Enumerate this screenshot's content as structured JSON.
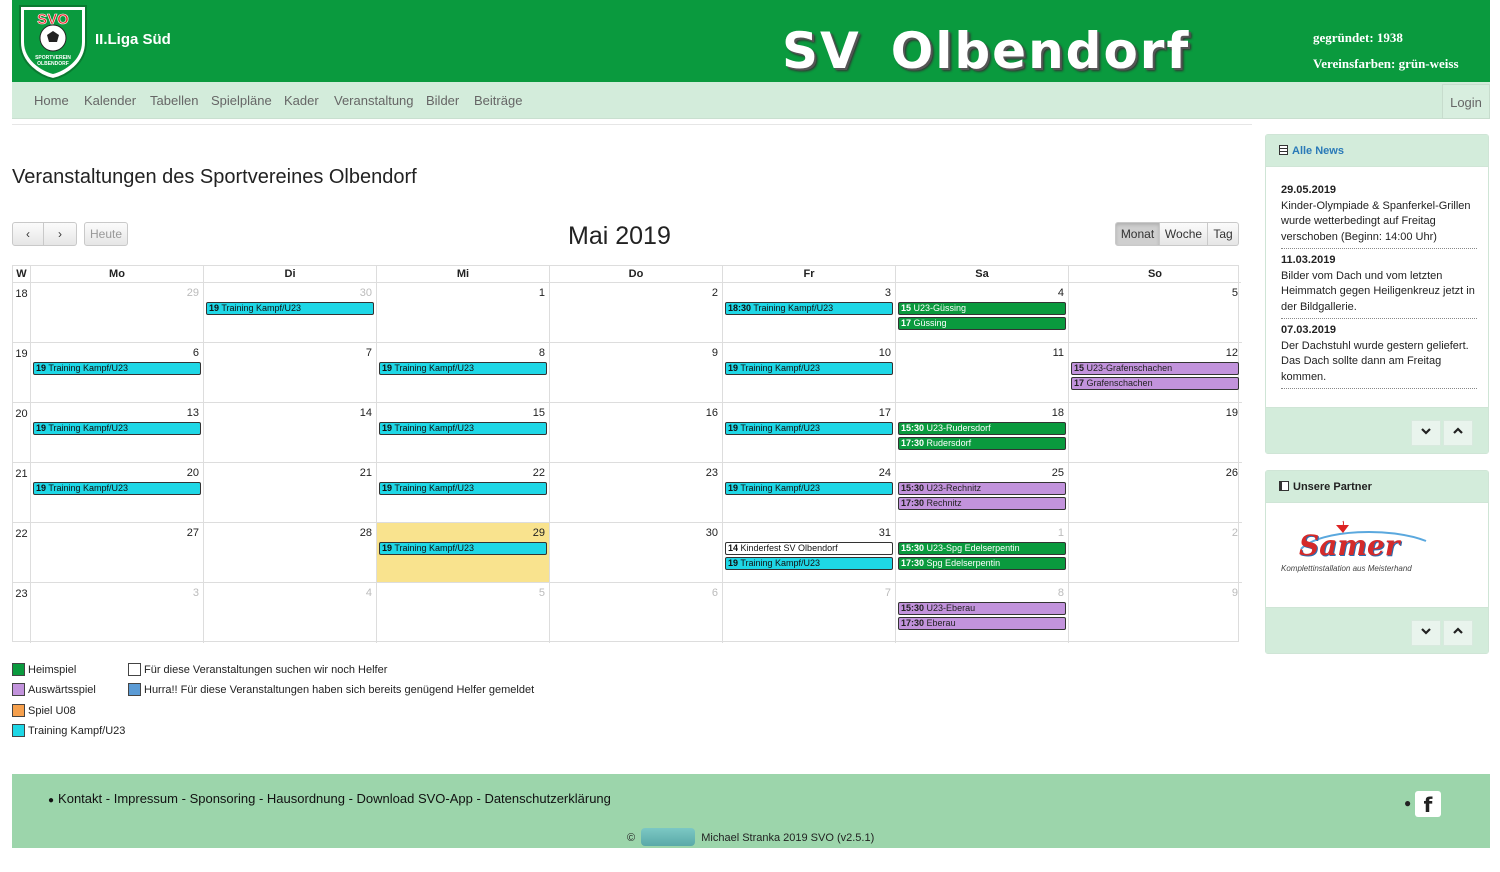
{
  "header": {
    "league": "II.Liga Süd",
    "club_title_part1": "SV",
    "club_title_part2": "Olbendorf",
    "founded": "gegründet: 1938",
    "club_colors": "Vereinsfarben: grün-weiss",
    "logo_text_top": "SVO",
    "logo_text_bottom": "SPORTVEREIN OLBENDORF"
  },
  "nav": {
    "items": [
      "Home",
      "Kalender",
      "Tabellen",
      "Spielpläne",
      "Kader",
      "Veranstaltung",
      "Bilder",
      "Beiträge"
    ],
    "login": "Login"
  },
  "page": {
    "title": "Veranstaltungen des Sportvereines Olbendorf"
  },
  "toolbar": {
    "prev": "‹",
    "next": "›",
    "today": "Heute",
    "title": "Mai 2019",
    "views": [
      "Monat",
      "Woche",
      "Tag"
    ],
    "active_view": "Monat"
  },
  "calendar": {
    "week_col_header": "W",
    "day_headers": [
      "Mo",
      "Di",
      "Mi",
      "Do",
      "Fr",
      "Sa",
      "So"
    ],
    "weeks": [
      {
        "week": "18",
        "days": [
          {
            "num": "29",
            "other": true,
            "events": []
          },
          {
            "num": "30",
            "other": true,
            "events": [
              {
                "time": "19",
                "text": "Training Kampf/U23",
                "type": "training"
              }
            ]
          },
          {
            "num": "1",
            "events": []
          },
          {
            "num": "2",
            "events": []
          },
          {
            "num": "3",
            "events": [
              {
                "time": "18:30",
                "text": "Training Kampf/U23",
                "type": "training"
              }
            ]
          },
          {
            "num": "4",
            "events": [
              {
                "time": "15",
                "text": "U23-Güssing",
                "type": "home"
              },
              {
                "time": "17",
                "text": "Güssing",
                "type": "home"
              }
            ]
          },
          {
            "num": "5",
            "events": []
          }
        ]
      },
      {
        "week": "19",
        "days": [
          {
            "num": "6",
            "events": [
              {
                "time": "19",
                "text": "Training Kampf/U23",
                "type": "training"
              }
            ]
          },
          {
            "num": "7",
            "events": []
          },
          {
            "num": "8",
            "events": [
              {
                "time": "19",
                "text": "Training Kampf/U23",
                "type": "training"
              }
            ]
          },
          {
            "num": "9",
            "events": []
          },
          {
            "num": "10",
            "events": [
              {
                "time": "19",
                "text": "Training Kampf/U23",
                "type": "training"
              }
            ]
          },
          {
            "num": "11",
            "events": []
          },
          {
            "num": "12",
            "events": [
              {
                "time": "15",
                "text": "U23-Grafenschachen",
                "type": "away"
              },
              {
                "time": "17",
                "text": "Grafenschachen",
                "type": "away"
              }
            ]
          }
        ]
      },
      {
        "week": "20",
        "days": [
          {
            "num": "13",
            "events": [
              {
                "time": "19",
                "text": "Training Kampf/U23",
                "type": "training"
              }
            ]
          },
          {
            "num": "14",
            "events": []
          },
          {
            "num": "15",
            "events": [
              {
                "time": "19",
                "text": "Training Kampf/U23",
                "type": "training"
              }
            ]
          },
          {
            "num": "16",
            "events": []
          },
          {
            "num": "17",
            "events": [
              {
                "time": "19",
                "text": "Training Kampf/U23",
                "type": "training"
              }
            ]
          },
          {
            "num": "18",
            "events": [
              {
                "time": "15:30",
                "text": "U23-Rudersdorf",
                "type": "home"
              },
              {
                "time": "17:30",
                "text": "Rudersdorf",
                "type": "home"
              }
            ]
          },
          {
            "num": "19",
            "events": []
          }
        ]
      },
      {
        "week": "21",
        "days": [
          {
            "num": "20",
            "events": [
              {
                "time": "19",
                "text": "Training Kampf/U23",
                "type": "training"
              }
            ]
          },
          {
            "num": "21",
            "events": []
          },
          {
            "num": "22",
            "events": [
              {
                "time": "19",
                "text": "Training Kampf/U23",
                "type": "training"
              }
            ]
          },
          {
            "num": "23",
            "events": []
          },
          {
            "num": "24",
            "events": [
              {
                "time": "19",
                "text": "Training Kampf/U23",
                "type": "training"
              }
            ]
          },
          {
            "num": "25",
            "events": [
              {
                "time": "15:30",
                "text": "U23-Rechnitz",
                "type": "away"
              },
              {
                "time": "17:30",
                "text": "Rechnitz",
                "type": "away"
              }
            ]
          },
          {
            "num": "26",
            "events": []
          }
        ]
      },
      {
        "week": "22",
        "days": [
          {
            "num": "27",
            "events": []
          },
          {
            "num": "28",
            "events": []
          },
          {
            "num": "29",
            "today": true,
            "events": [
              {
                "time": "19",
                "text": "Training Kampf/U23",
                "type": "training"
              }
            ]
          },
          {
            "num": "30",
            "events": []
          },
          {
            "num": "31",
            "events": [
              {
                "time": "14",
                "text": "Kinderfest SV Olbendorf",
                "type": "helper"
              },
              {
                "time": "19",
                "text": "Training Kampf/U23",
                "type": "training"
              }
            ]
          },
          {
            "num": "1",
            "other": true,
            "events": [
              {
                "time": "15:30",
                "text": "U23-Spg Edelserpentin",
                "type": "home"
              },
              {
                "time": "17:30",
                "text": "Spg Edelserpentin",
                "type": "home"
              }
            ]
          },
          {
            "num": "2",
            "other": true,
            "events": []
          }
        ]
      },
      {
        "week": "23",
        "days": [
          {
            "num": "3",
            "other": true,
            "events": []
          },
          {
            "num": "4",
            "other": true,
            "events": []
          },
          {
            "num": "5",
            "other": true,
            "events": []
          },
          {
            "num": "6",
            "other": true,
            "events": []
          },
          {
            "num": "7",
            "other": true,
            "events": []
          },
          {
            "num": "8",
            "other": true,
            "events": [
              {
                "time": "15:30",
                "text": "U23-Eberau",
                "type": "away"
              },
              {
                "time": "17:30",
                "text": "Eberau",
                "type": "away"
              }
            ]
          },
          {
            "num": "9",
            "other": true,
            "events": []
          }
        ]
      }
    ]
  },
  "legend": {
    "items": [
      {
        "label": "Heimspiel",
        "color": "#0a9a3e"
      },
      {
        "label": "Auswärtsspiel",
        "color": "#c293dc"
      },
      {
        "label": "Spiel U08",
        "color": "#f6a04d"
      },
      {
        "label": "Training Kampf/U23",
        "color": "#1ed7e6"
      },
      {
        "label": "Für diese Veranstaltungen suchen wir noch Helfer",
        "color": "#ffffff"
      },
      {
        "label": "Hurra!! Für diese Veranstaltungen haben sich bereits genügend Helfer gemeldet",
        "color": "#5b9bd5"
      }
    ]
  },
  "sidebar": {
    "news_title": "Alle News",
    "news": [
      {
        "date": "29.05.2019",
        "text": "Kinder-Olympiade & Spanferkel-Grillen wurde wetterbedingt auf Freitag verschoben (Beginn: 14:00 Uhr)"
      },
      {
        "date": "11.03.2019",
        "text": "Bilder vom Dach und vom letzten Heimmatch gegen Heiligenkreuz jetzt in der Bildgallerie."
      },
      {
        "date": "07.03.2019",
        "text": "Der Dachstuhl wurde gestern geliefert. Das Dach sollte dann am Freitag kommen."
      }
    ],
    "partner_title": "Unsere Partner",
    "partner_name": "Samer",
    "partner_tagline": "Komplettinstallation aus Meisterhand"
  },
  "footer": {
    "links": [
      "Kontakt",
      "Impressum",
      "Sponsoring",
      "Hausordnung",
      "Download SVO-App",
      "Datenschutzerklärung"
    ],
    "copyright_symbol": "©",
    "copyright_text": "Michael Stranka 2019 SVO (v2.5.1)"
  },
  "colors": {
    "brand_green": "#0a9a3e",
    "nav_bg": "#d3ecdb",
    "footer_bg": "#9cd5ab",
    "today_bg": "#f9e38e"
  }
}
